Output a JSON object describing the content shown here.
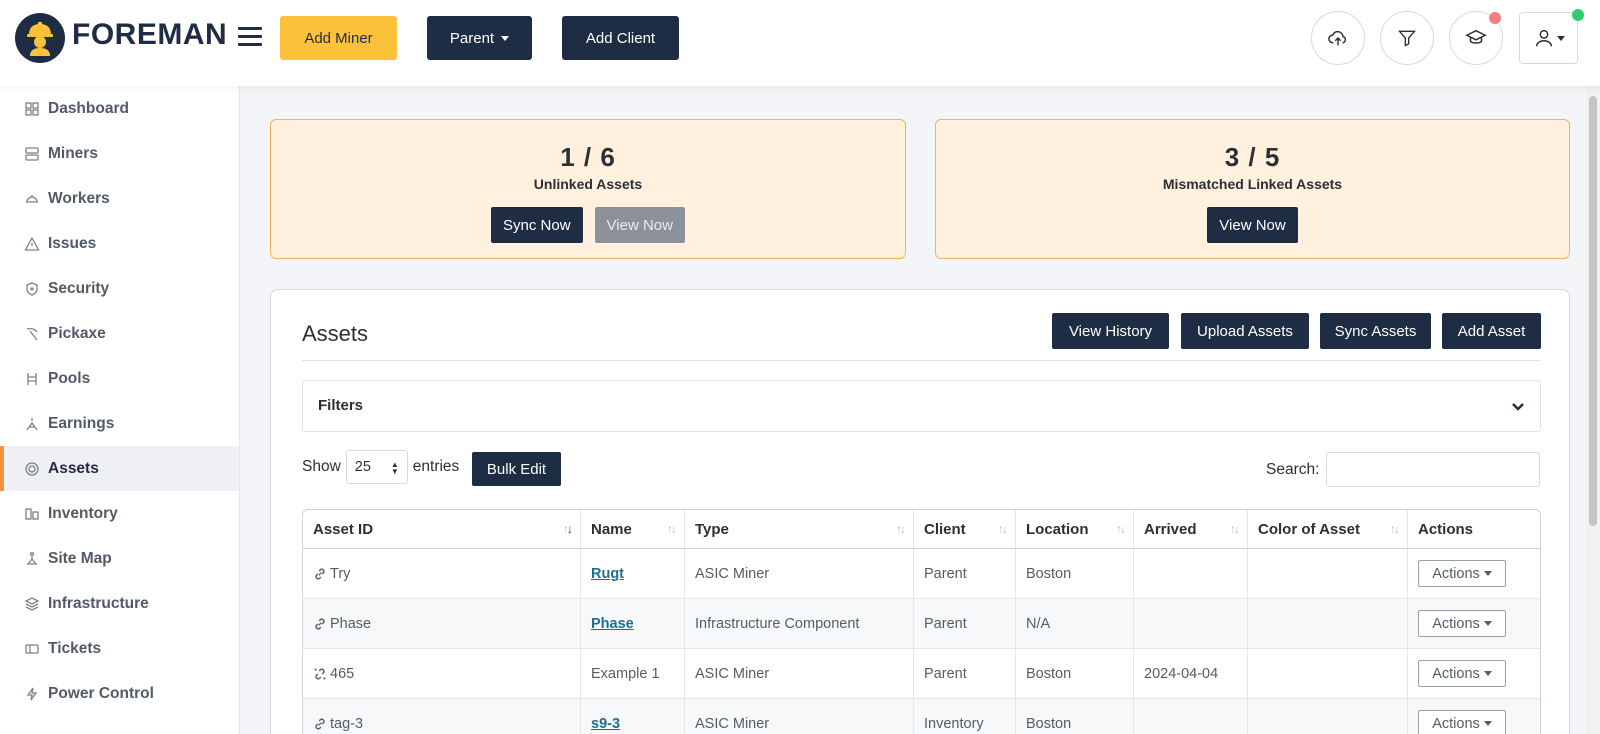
{
  "header": {
    "brand": "FOREMAN",
    "add_miner": "Add Miner",
    "parent": "Parent",
    "add_client": "Add Client"
  },
  "sidebar": {
    "items": [
      {
        "label": "Dashboard",
        "icon": "dashboard-icon"
      },
      {
        "label": "Miners",
        "icon": "server-icon"
      },
      {
        "label": "Workers",
        "icon": "hardhat-icon"
      },
      {
        "label": "Issues",
        "icon": "warning-icon"
      },
      {
        "label": "Security",
        "icon": "shield-icon"
      },
      {
        "label": "Pickaxe",
        "icon": "pickaxe-icon"
      },
      {
        "label": "Pools",
        "icon": "pool-icon"
      },
      {
        "label": "Earnings",
        "icon": "earnings-icon"
      },
      {
        "label": "Assets",
        "icon": "gear-icon",
        "active": true
      },
      {
        "label": "Inventory",
        "icon": "inventory-icon"
      },
      {
        "label": "Site Map",
        "icon": "sitemap-icon"
      },
      {
        "label": "Infrastructure",
        "icon": "layers-icon"
      },
      {
        "label": "Tickets",
        "icon": "ticket-icon"
      },
      {
        "label": "Power Control",
        "icon": "bolt-icon"
      }
    ]
  },
  "cards": {
    "unlinked": {
      "value": "1 / 6",
      "label": "Unlinked Assets",
      "sync": "Sync Now",
      "view": "View Now"
    },
    "mismatched": {
      "value": "3 / 5",
      "label": "Mismatched Linked Assets",
      "view": "View Now"
    }
  },
  "assets": {
    "title": "Assets",
    "view_history": "View History",
    "upload_assets": "Upload Assets",
    "sync_assets": "Sync Assets",
    "add_asset": "Add Asset",
    "filters": "Filters",
    "show": "Show",
    "entries_value": "25",
    "entries": "entries",
    "bulk_edit": "Bulk Edit",
    "search_label": "Search:",
    "search_value": ""
  },
  "table": {
    "columns": [
      "Asset ID",
      "Name",
      "Type",
      "Client",
      "Location",
      "Arrived",
      "Color of Asset",
      "Actions"
    ],
    "rows": [
      {
        "asset_id": "Try",
        "name": "Rugt",
        "type": "ASIC Miner",
        "client": "Parent",
        "location": "Boston",
        "arrived": "",
        "color": "",
        "actions": "Actions",
        "linked": true
      },
      {
        "asset_id": "Phase",
        "name": "Phase",
        "type": "Infrastructure Component",
        "client": "Parent",
        "location": "N/A",
        "arrived": "",
        "color": "",
        "actions": "Actions",
        "linked": true
      },
      {
        "asset_id": "465",
        "name": "Example 1",
        "type": "ASIC Miner",
        "client": "Parent",
        "location": "Boston",
        "arrived": "2024-04-04",
        "color": "",
        "actions": "Actions",
        "linked": false
      },
      {
        "asset_id": "tag-3",
        "name": "s9-3",
        "type": "ASIC Miner",
        "client": "Inventory",
        "location": "Boston",
        "arrived": "",
        "color": "",
        "actions": "Actions",
        "linked": true
      }
    ]
  },
  "colors": {
    "navy": "#1f2d44",
    "yellow": "#fbc13a",
    "card_bg": "#fff1de",
    "card_border": "#f0b45c",
    "active_bar": "#f5923e",
    "link": "#1e6f8f"
  }
}
